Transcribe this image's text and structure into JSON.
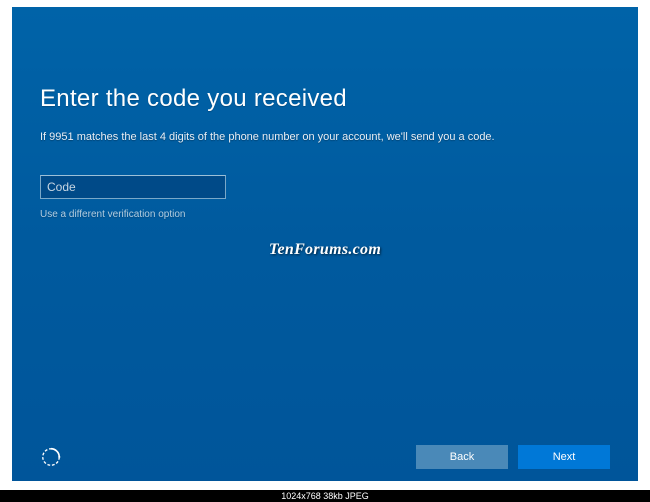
{
  "heading": "Enter the code you received",
  "subtext": "If 9951 matches the last 4 digits of the phone number on your account, we'll send you a code.",
  "code_input": {
    "placeholder": "Code",
    "value": ""
  },
  "alt_link": "Use a different verification option",
  "watermark": "TenForums.com",
  "buttons": {
    "back": "Back",
    "next": "Next"
  },
  "footer": "1024x768   38kb   JPEG"
}
